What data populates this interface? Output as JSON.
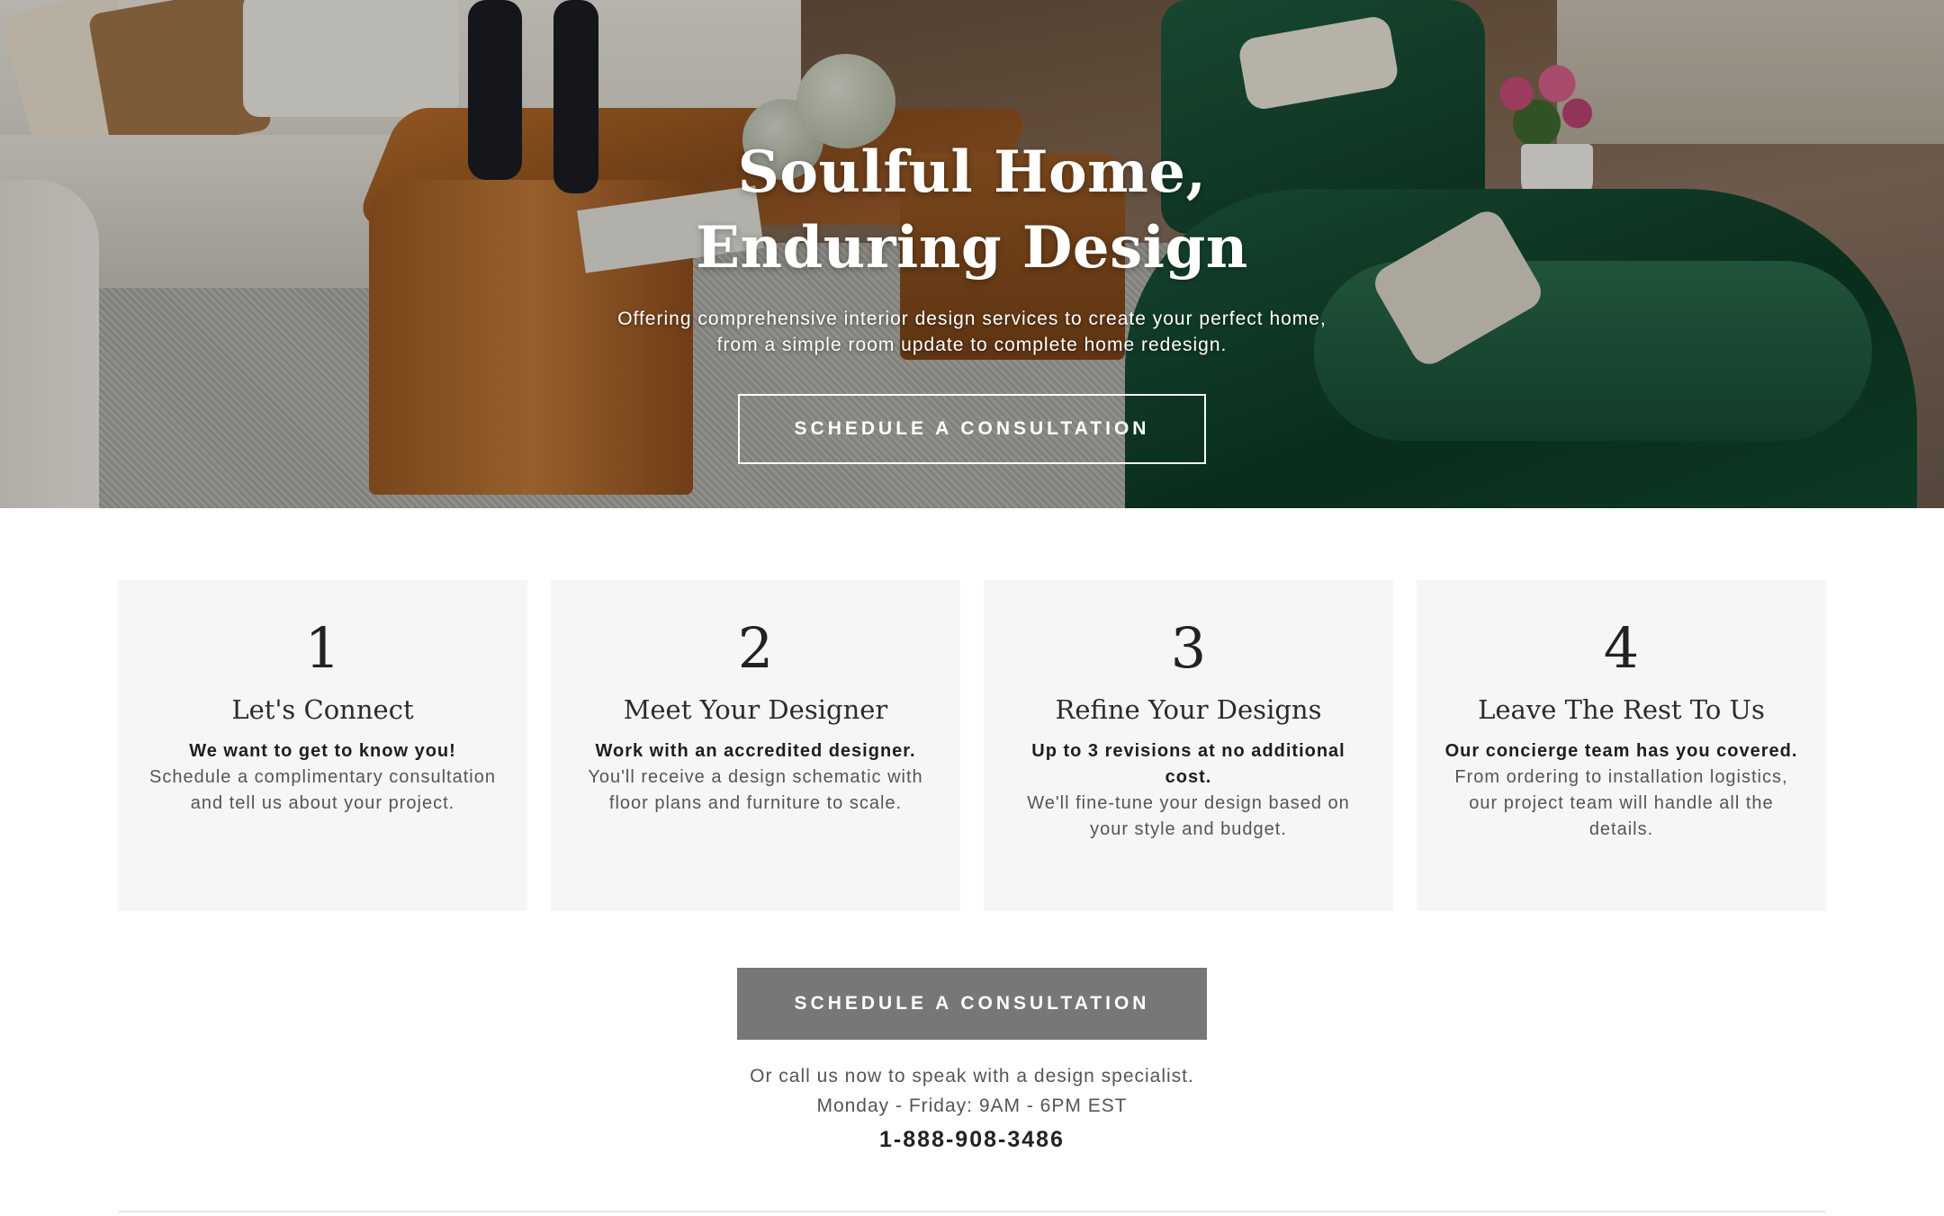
{
  "hero": {
    "title_line1": "Soulful Home,",
    "title_line2": "Enduring Design",
    "subtitle_line1": "Offering comprehensive interior design services to create your perfect home,",
    "subtitle_line2": "from a simple room update to complete home redesign.",
    "cta_label": "SCHEDULE A CONSULTATION"
  },
  "steps": [
    {
      "number": "1",
      "title": "Let's Connect",
      "lead": "We want to get to know you!",
      "body": "Schedule a complimentary consultation and tell us about your project."
    },
    {
      "number": "2",
      "title": "Meet Your Designer",
      "lead": "Work with an accredited designer.",
      "body": "You'll receive a design schematic with floor plans and furniture to scale."
    },
    {
      "number": "3",
      "title": "Refine Your Designs",
      "lead": "Up to 3 revisions at no additional cost.",
      "body": "We'll fine-tune your design based on your style and budget."
    },
    {
      "number": "4",
      "title": "Leave The Rest To Us",
      "lead": "Our concierge team has you covered.",
      "body": "From ordering to installation logistics, our project team will handle all the details."
    }
  ],
  "cta": {
    "button_label": "SCHEDULE A CONSULTATION",
    "call_text": "Or call us now to speak with a design specialist.",
    "hours": "Monday - Friday: 9AM - 6PM EST",
    "phone": "1-888-908-3486"
  }
}
